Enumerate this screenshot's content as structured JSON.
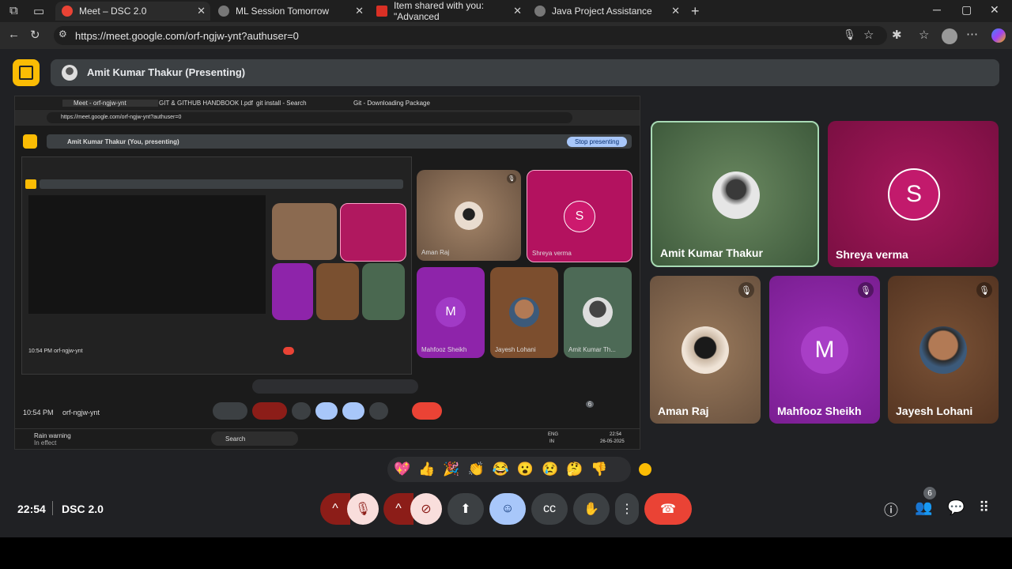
{
  "tabs": [
    {
      "title": "Meet – DSC 2.0"
    },
    {
      "title": "ML Session Tomorrow"
    },
    {
      "title": "Item shared with you: \"Advanced"
    },
    {
      "title": "Java Project Assistance"
    }
  ],
  "address": {
    "url": "https://meet.google.com/orf-ngjw-ynt?authuser=0"
  },
  "presenter": {
    "label": "Amit Kumar Thakur (Presenting)"
  },
  "shared_screen": {
    "tabs": [
      "Meet - orf-ngjw-ynt",
      "GIT & GITHUB HANDBOOK I.pdf",
      "git install - Search",
      "Git - Downloading Package"
    ],
    "url": "https://meet.google.com/orf-ngjw-ynt?authuser=0",
    "presenting_label": "Amit Kumar Thakur (You, presenting)",
    "stop_button": "Stop presenting",
    "tiles": [
      "Aman Raj",
      "Shreya verma",
      "Mahfooz Sheikh",
      "Jayesh Lohani",
      "Amit Kumar Th..."
    ],
    "inner_time": "10:54 PM",
    "inner_code": "orf-ngjw-ynt",
    "weather_title": "Rain warning",
    "weather_sub": "In effect",
    "search": "Search",
    "lang": "ENG",
    "region": "IN",
    "tray_time": "22:54",
    "tray_date": "26-05-2025",
    "people_count": "6",
    "nested_time": "10:54 PM",
    "nested_code": "orf-ngjw-ynt"
  },
  "participants": [
    {
      "name": "Amit Kumar Thakur"
    },
    {
      "name": "Shreya verma",
      "initial": "S"
    },
    {
      "name": "Aman Raj"
    },
    {
      "name": "Mahfooz Sheikh",
      "initial": "M"
    },
    {
      "name": "Jayesh Lohani"
    }
  ],
  "reactions": [
    "💖",
    "👍",
    "🎉",
    "👏",
    "😂",
    "😮",
    "😢",
    "🤔",
    "👎"
  ],
  "footer": {
    "time": "22:54",
    "meeting": "DSC 2.0",
    "people_count": "6"
  },
  "colors": {
    "accent_green": "#a8dab5",
    "end_call": "#ea4335",
    "logo": "#fbbc04",
    "magenta": "#a5185b",
    "purple": "#8e24aa"
  }
}
